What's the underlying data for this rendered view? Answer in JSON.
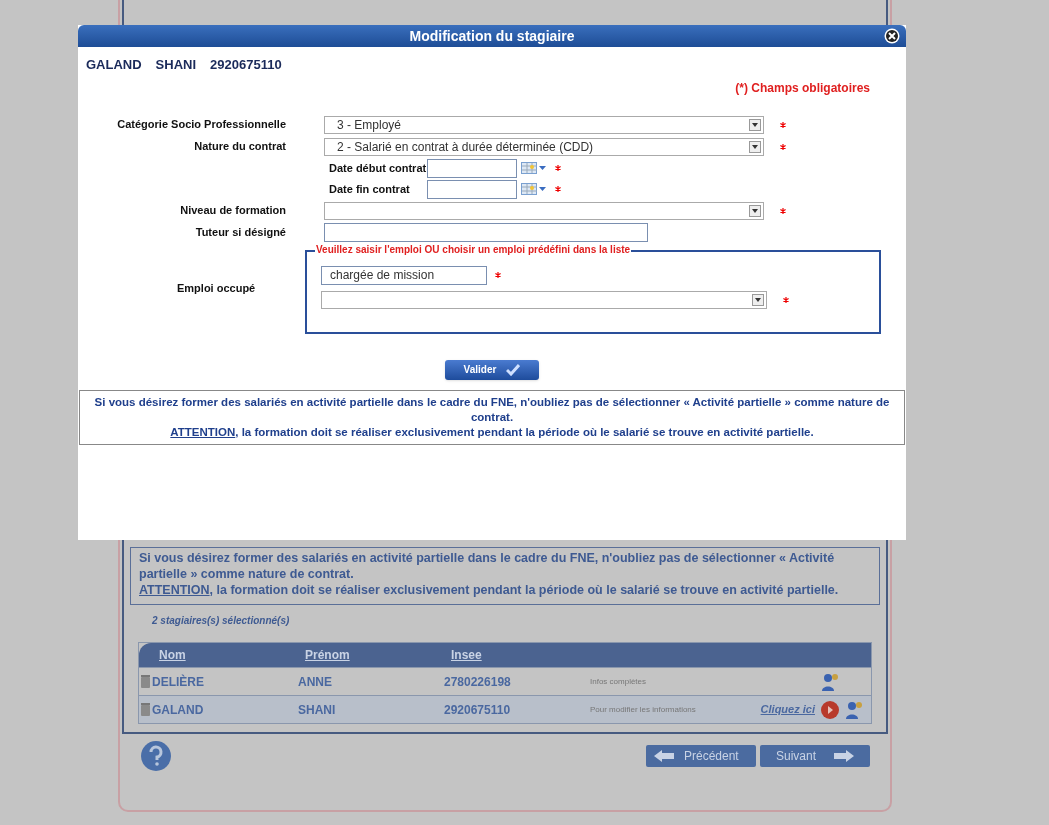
{
  "background": {
    "notice": {
      "line1": "Si vous désirez former des salariés en activité partielle dans le cadre du FNE, n'oubliez pas de sélectionner « Activité partielle » comme nature de contrat.",
      "attention": "ATTENTION",
      "line2": ", la formation doit se réaliser exclusivement pendant la période où le salarié se trouve en activité partielle."
    },
    "count": "2 stagiaires(s) sélectionné(s)",
    "table": {
      "columns": [
        "Nom",
        "Prénom",
        "Insee"
      ],
      "rows": [
        {
          "nom": "DELIÈRE",
          "prenom": "ANNE",
          "insee": "2780226198",
          "info": "Infos complètes",
          "selected": false
        },
        {
          "nom": "GALAND",
          "prenom": "SHANI",
          "insee": "2920675110",
          "info": "Pour modifier les informations",
          "link": "Cliquez ici",
          "selected": true
        }
      ]
    },
    "buttons": {
      "previous": "Précédent",
      "next": "Suivant"
    }
  },
  "modal": {
    "title": "Modification du stagiaire",
    "trainee": [
      "GALAND",
      "SHANI",
      "2920675110"
    ],
    "required_note": "(*) Champs obligatoires",
    "fields": [
      {
        "kind": "select",
        "label": "Catégorie Socio Professionnelle",
        "value": "3 - Employé",
        "required": true
      },
      {
        "kind": "select",
        "label": "Nature du contrat",
        "value": "2 - Salarié en contrat à durée déterminée (CDD)",
        "required": true
      },
      {
        "kind": "date",
        "label": "Date début contrat",
        "required": true
      },
      {
        "kind": "date",
        "label": "Date fin contrat",
        "required": true
      },
      {
        "kind": "select",
        "label": "Niveau de formation",
        "required": true
      },
      {
        "kind": "text",
        "label": "Tuteur si désigné",
        "required": false
      }
    ],
    "job": {
      "legend": "Veuillez saisir l'emploi OU choisir un emploi prédéfini dans la liste",
      "label": "Emploi occupé",
      "value": "chargée de mission",
      "required": true
    },
    "validate": "Valider",
    "notice": {
      "line1": "Si vous désirez former des salariés en activité partielle dans le cadre du FNE, n'oubliez pas de sélectionner « Activité partielle » comme nature de contrat.",
      "attention": "ATTENTION",
      "line2": ", la formation doit se réaliser exclusivement pendant la période où le salarié se trouve en activité partielle."
    }
  }
}
